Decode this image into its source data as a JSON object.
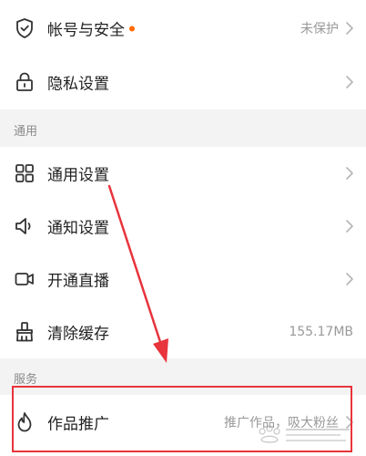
{
  "settings": {
    "account_security": {
      "label": "帐号与安全",
      "status": "未保护",
      "icon": "shield-check-icon",
      "dot_color": "#ff6a00"
    },
    "privacy": {
      "label": "隐私设置",
      "icon": "lock-icon"
    },
    "general_section": {
      "title": "通用"
    },
    "general_settings": {
      "label": "通用设置",
      "icon": "grid-icon"
    },
    "notification_settings": {
      "label": "通知设置",
      "icon": "speaker-icon"
    },
    "live_stream": {
      "label": "开通直播",
      "icon": "video-camera-icon"
    },
    "clear_cache": {
      "label": "清除缓存",
      "value": "155.17MB",
      "icon": "broom-icon"
    },
    "services_section": {
      "title": "服务"
    },
    "promotion": {
      "label": "作品推广",
      "value": "推广作品，吸大粉丝",
      "icon": "flame-icon"
    }
  },
  "annotation": {
    "box_color": "#e8343c",
    "arrow_color": "#e8343c"
  }
}
